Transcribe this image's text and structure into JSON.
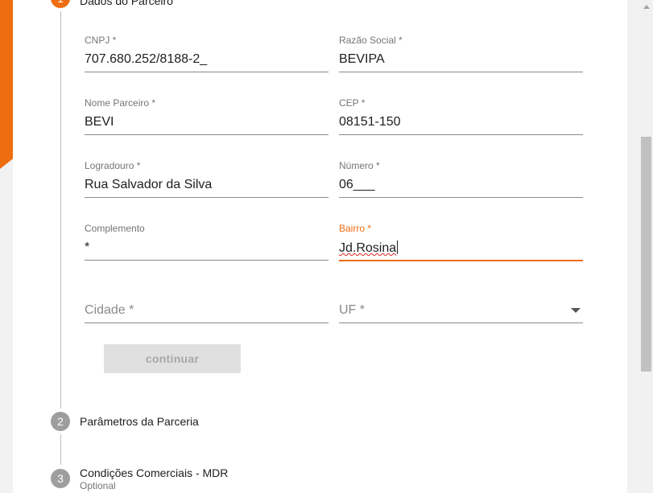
{
  "steps": [
    {
      "number": "1",
      "title": "Dados do Parceiro"
    },
    {
      "number": "2",
      "title": "Parâmetros da Parceria"
    },
    {
      "number": "3",
      "title": "Condições Comerciais - MDR",
      "optional": "Optional"
    }
  ],
  "form": {
    "cnpj": {
      "label": "CNPJ *",
      "value": "707.680.252/8188-2_"
    },
    "razao_social": {
      "label": "Razão Social *",
      "value": "BEVIPA"
    },
    "nome_parceiro": {
      "label": "Nome Parceiro *",
      "value": "BEVI"
    },
    "cep": {
      "label": "CEP *",
      "value": "08151-150"
    },
    "logradouro": {
      "label": "Logradouro *",
      "value": "Rua Salvador da Silva"
    },
    "numero": {
      "label": "Número *",
      "value": "06___"
    },
    "complemento": {
      "label": "Complemento",
      "value": "*"
    },
    "bairro": {
      "label": "Bairro *",
      "value": "Jd.Rosina"
    },
    "cidade": {
      "placeholder": "Cidade *"
    },
    "uf": {
      "placeholder": "UF *"
    }
  },
  "continue_label": "continuar",
  "colors": {
    "accent": "#ee6d10",
    "step_inactive": "#9e9e9e",
    "button_disabled": "#e0e0e0"
  }
}
